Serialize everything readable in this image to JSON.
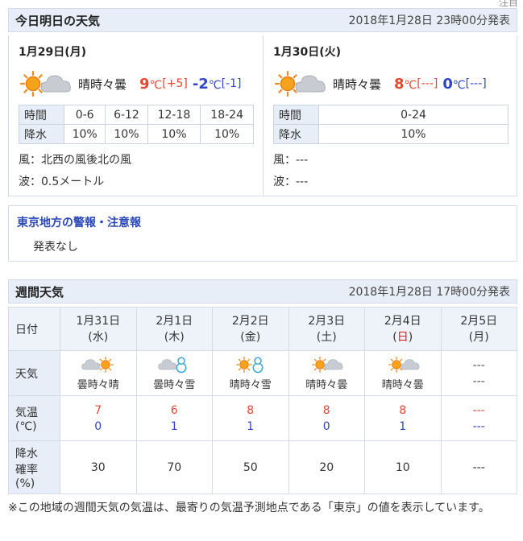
{
  "top_cut": "注目",
  "today": {
    "title": "今日明日の天気",
    "issued": "2018年1月28日 23時00分発表",
    "days": [
      {
        "date": "1月29日(月)",
        "weather": "晴時々曇",
        "icon": "sun-and-cloud",
        "hi": "9",
        "hi_diff": "[+5]",
        "lo": "-2",
        "lo_diff": "[-1]",
        "unit": "℃",
        "time_label": "時間",
        "rain_label": "降水",
        "times": [
          "0-6",
          "6-12",
          "12-18",
          "18-24"
        ],
        "rain": [
          "10%",
          "10%",
          "10%",
          "10%"
        ],
        "wind": "風：北西の風後北の風",
        "wave": "波：0.5メートル"
      },
      {
        "date": "1月30日(火)",
        "weather": "晴時々曇",
        "icon": "sun-and-cloud",
        "hi": "8",
        "hi_diff": "[---]",
        "lo": "0",
        "lo_diff": "[---]",
        "unit": "℃",
        "time_label": "時間",
        "rain_label": "降水",
        "times": [
          "0-24"
        ],
        "rain": [
          "10%"
        ],
        "wind": "風：---",
        "wave": "波：---"
      }
    ]
  },
  "warning": {
    "title": "東京地方の警報・注意報",
    "body": "発表なし"
  },
  "weekly": {
    "title": "週間天気",
    "issued": "2018年1月28日 17時00分発表",
    "labels": {
      "date": "日付",
      "weather": "天気",
      "temp_1": "気温",
      "temp_2": "(℃)",
      "pop_1": "降水",
      "pop_2": "確率",
      "pop_3": "(%)"
    },
    "days": [
      {
        "date": "1月31日",
        "dow": "(水)",
        "weather": "曇時々晴",
        "icon": "cloud-and-sun",
        "hi": "7",
        "lo": "0",
        "pop": "30"
      },
      {
        "date": "2月1日",
        "dow": "(木)",
        "weather": "曇時々雪",
        "icon": "cloud-and-snow",
        "hi": "6",
        "lo": "1",
        "pop": "70"
      },
      {
        "date": "2月2日",
        "dow": "(金)",
        "weather": "晴時々雪",
        "icon": "sun-and-snow",
        "hi": "8",
        "lo": "1",
        "pop": "50"
      },
      {
        "date": "2月3日",
        "dow_open": "(",
        "dow_day": "土",
        "dow_close": ")",
        "weather": "晴時々曇",
        "icon": "sun-and-cloud",
        "hi": "8",
        "lo": "0",
        "pop": "20"
      },
      {
        "date": "2月4日",
        "dow_open": "(",
        "dow_day": "日",
        "dow_close": ")",
        "weather": "晴時々曇",
        "icon": "sun-and-cloud",
        "hi": "8",
        "lo": "1",
        "pop": "10"
      },
      {
        "date": "2月5日",
        "dow": "(月)",
        "weather_1": "---",
        "weather_2": "---",
        "hi": "---",
        "lo": "---",
        "pop": "---"
      }
    ]
  },
  "note": "※この地域の週間天気の気温は、最寄りの気温予測地点である「東京」の値を表示しています。",
  "colors": {
    "header_bg": "#e8eef7",
    "hi_temp": "#e8462f",
    "lo_temp": "#2f46c9",
    "warn_title": "#2a47b7",
    "sunday": "#d21a1a"
  }
}
